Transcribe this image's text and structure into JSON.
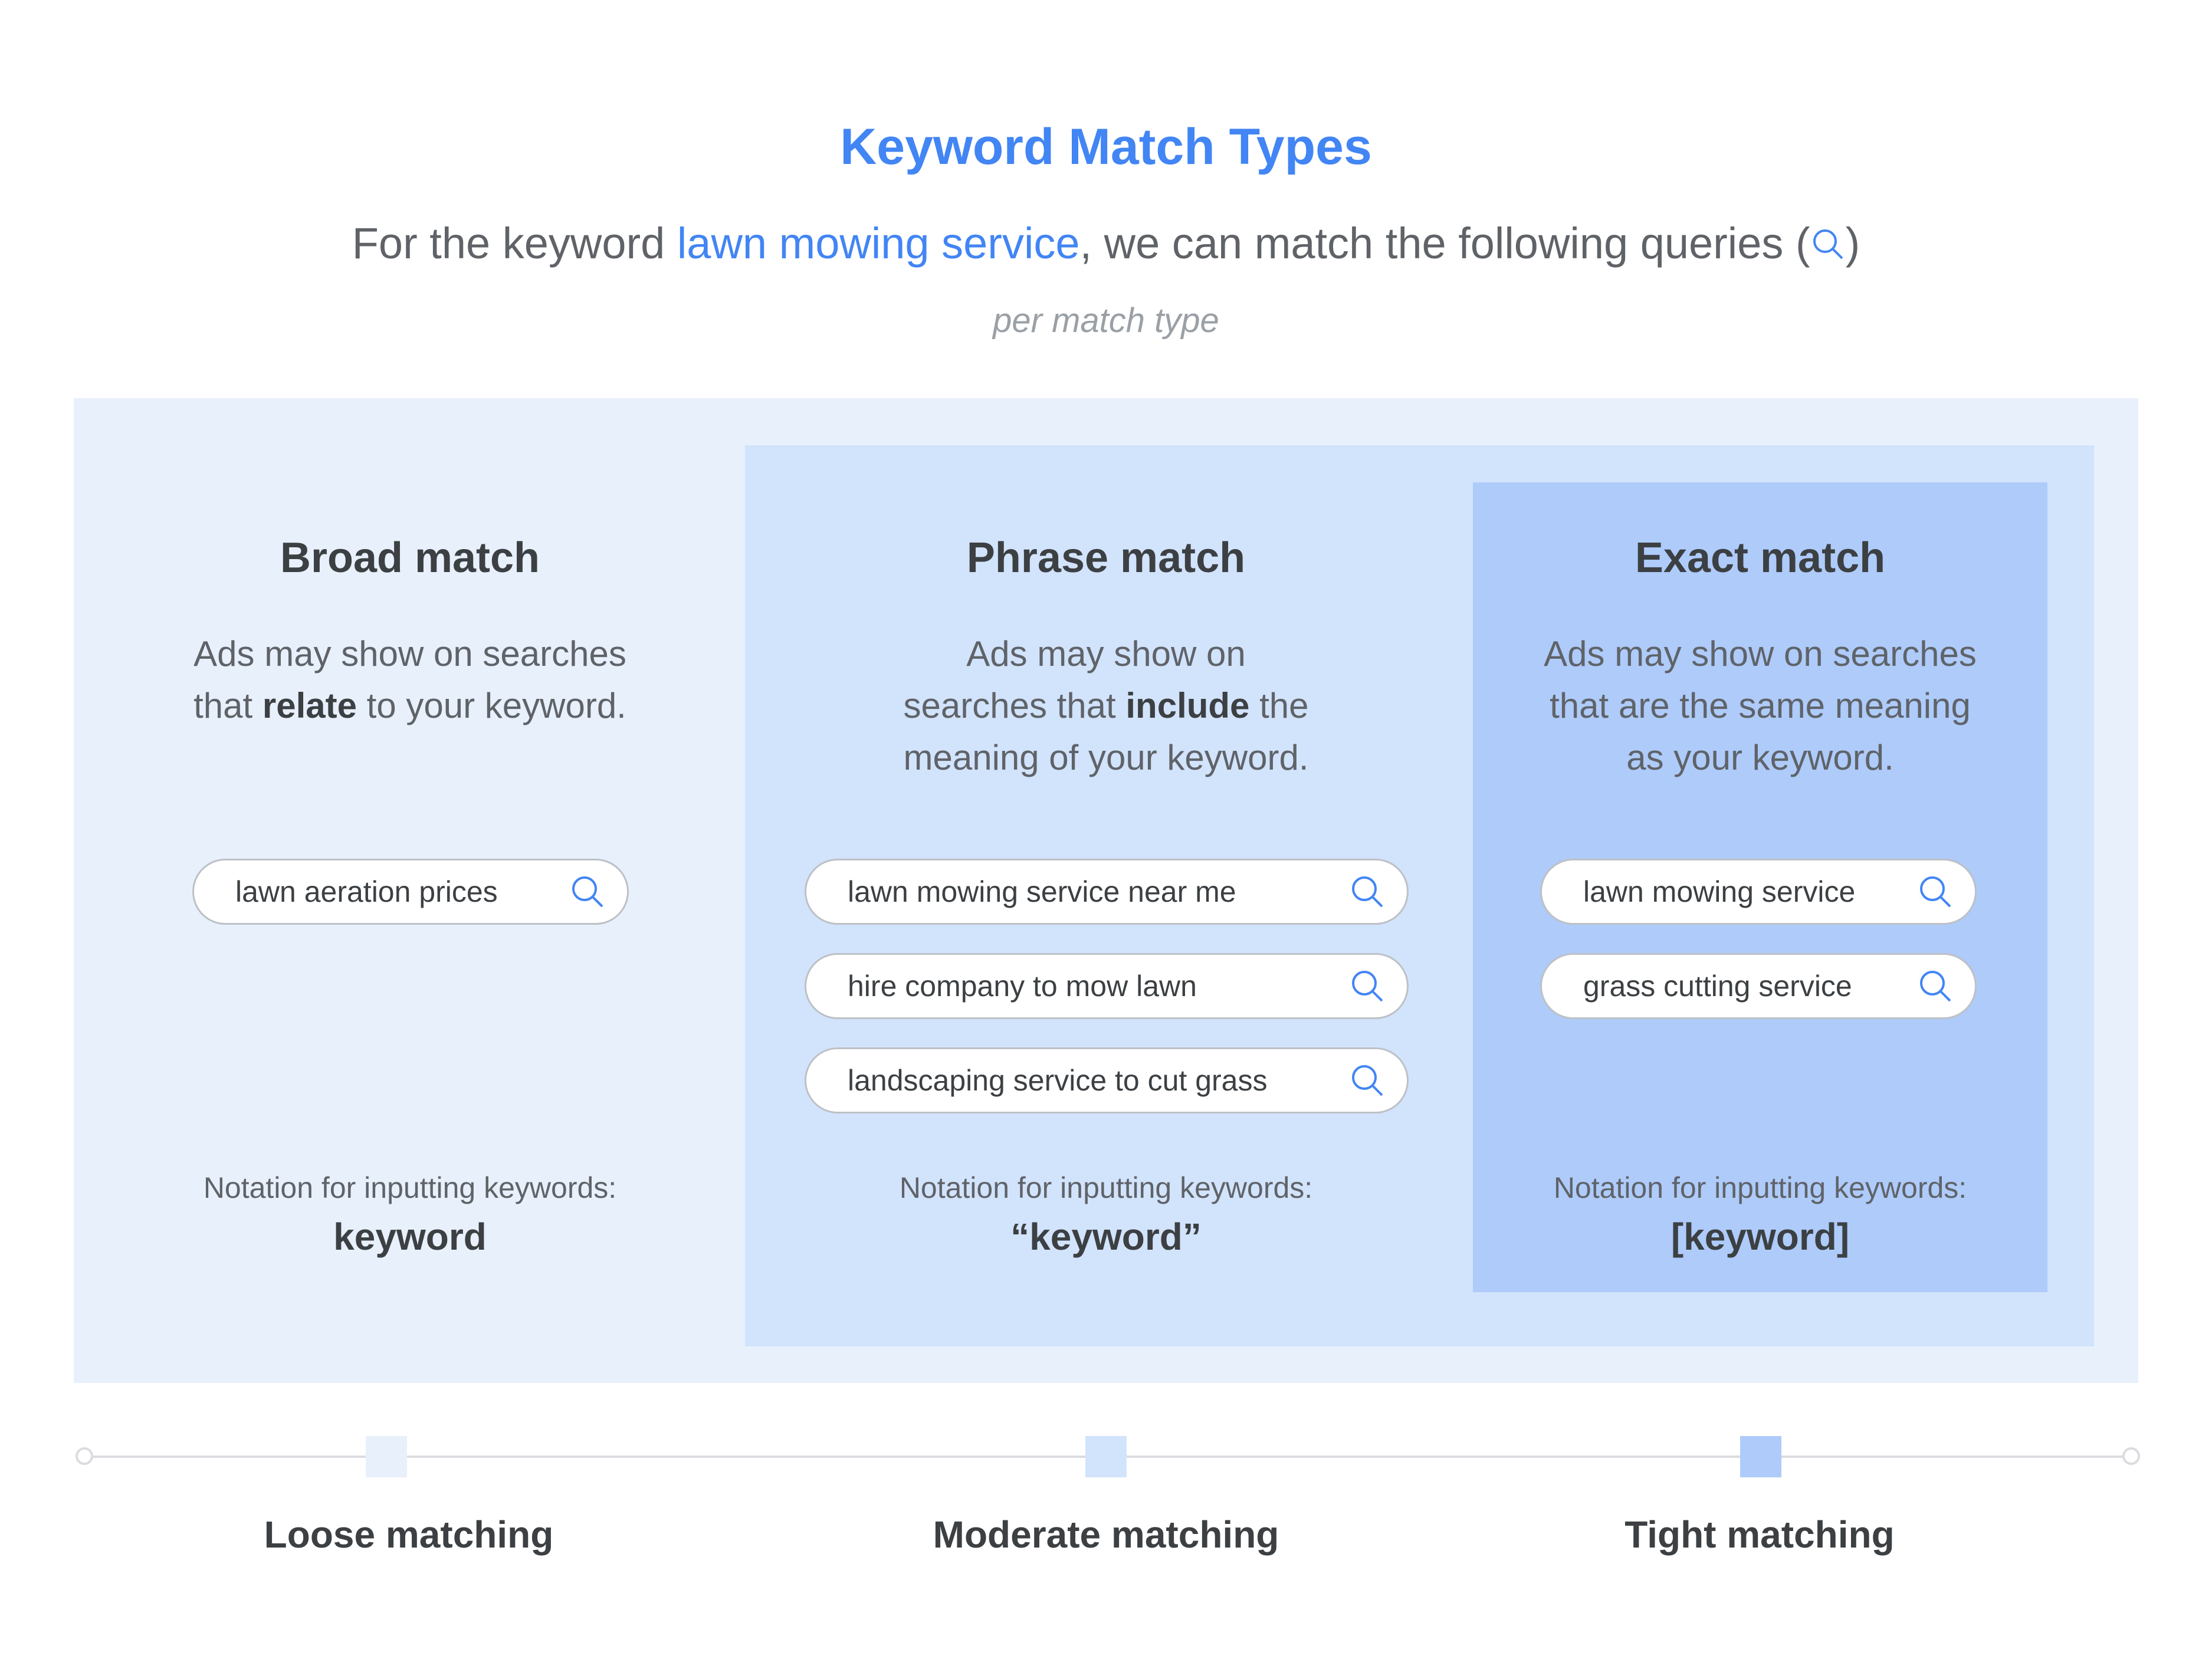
{
  "header": {
    "title": "Keyword Match Types",
    "subtitle_prefix": "For the keyword ",
    "subtitle_keyword": "lawn mowing service",
    "subtitle_suffix": ", we can match the following queries (",
    "subtitle_icon": "search-icon",
    "subtitle_close": ")",
    "note": "per match type"
  },
  "colors": {
    "accent": "#4285f4",
    "broad_bg": "#e8f0fc",
    "phrase_bg": "#d2e3fc",
    "exact_bg": "#aecbfa",
    "text_dark": "#3c4043",
    "text_mid": "#5f6368",
    "text_light": "#9aa0a6"
  },
  "columns": [
    {
      "title": "Broad match",
      "desc_lines": [
        {
          "pre": "Ads may show on searches",
          "bold": "",
          "post": ""
        },
        {
          "pre": "that ",
          "bold": "relate",
          "post": " to your keyword."
        }
      ],
      "queries": [
        "lawn aeration prices"
      ],
      "notation_label": "Notation for inputting keywords:",
      "notation_value": "keyword"
    },
    {
      "title": "Phrase match",
      "desc_lines": [
        {
          "pre": "Ads may show on",
          "bold": "",
          "post": ""
        },
        {
          "pre": "searches that ",
          "bold": "include",
          "post": " the"
        },
        {
          "pre": "meaning of your keyword.",
          "bold": "",
          "post": ""
        }
      ],
      "queries": [
        "lawn mowing service near me",
        "hire company to mow lawn",
        "landscaping service to cut grass"
      ],
      "notation_label": "Notation for inputting keywords:",
      "notation_value": "“keyword”"
    },
    {
      "title": "Exact match",
      "desc_lines": [
        {
          "pre": "Ads may show on searches",
          "bold": "",
          "post": ""
        },
        {
          "pre": "that are the same meaning",
          "bold": "",
          "post": ""
        },
        {
          "pre": "as your keyword.",
          "bold": "",
          "post": ""
        }
      ],
      "queries": [
        "lawn mowing service",
        "grass cutting service"
      ],
      "notation_label": "Notation for inputting keywords:",
      "notation_value": "[keyword]"
    }
  ],
  "scale": {
    "labels": [
      "Loose matching",
      "Moderate matching",
      "Tight matching"
    ],
    "marker_colors": [
      "#e8f0fc",
      "#d2e3fc",
      "#aecbfa"
    ]
  }
}
